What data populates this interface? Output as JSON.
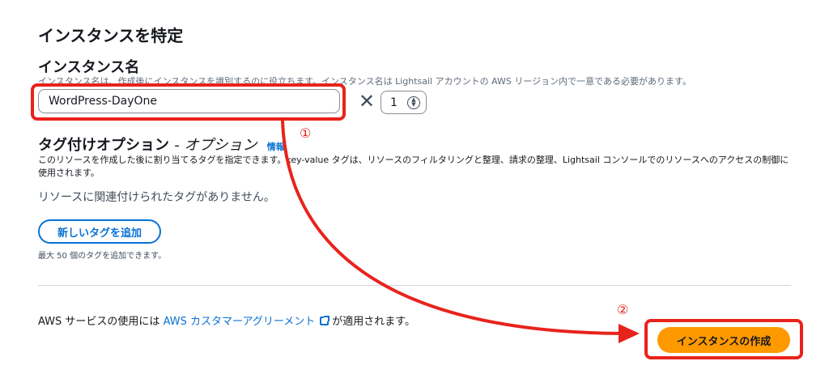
{
  "section": {
    "title": "インスタンスを特定"
  },
  "instance_name": {
    "label": "インスタンス名",
    "description": "インスタンス名は、作成後にインスタンスを識別するのに役立ちます。インスタンス名は Lightsail アカウントの AWS リージョン内で一意である必要があります。",
    "value": "WordPress-DayOne",
    "quantity": "1"
  },
  "tags": {
    "title": "タグ付けオプション",
    "title_suffix": "- オプション",
    "info_link": "情報",
    "description": "このリソースを作成した後に割り当てるタグを指定できます。key-value タグは、リソースのフィルタリングと整理、請求の整理、Lightsail コンソールでのリソースへのアクセスの制御に使用されます。",
    "empty_message": "リソースに関連付けられたタグがありません。",
    "add_button": "新しいタグを追加",
    "limit_note": "最大 50 個のタグを追加できます。"
  },
  "footer": {
    "agreement_prefix": "AWS サービスの使用には",
    "agreement_link": "AWS カスタマーアグリーメント",
    "agreement_suffix": "が適用されます。",
    "create_button": "インスタンスの作成"
  },
  "annotations": {
    "step1": "①",
    "step2": "②",
    "color": "#e8231c"
  },
  "colors": {
    "link": "#0972d3",
    "primary_button": "#ff9900"
  }
}
